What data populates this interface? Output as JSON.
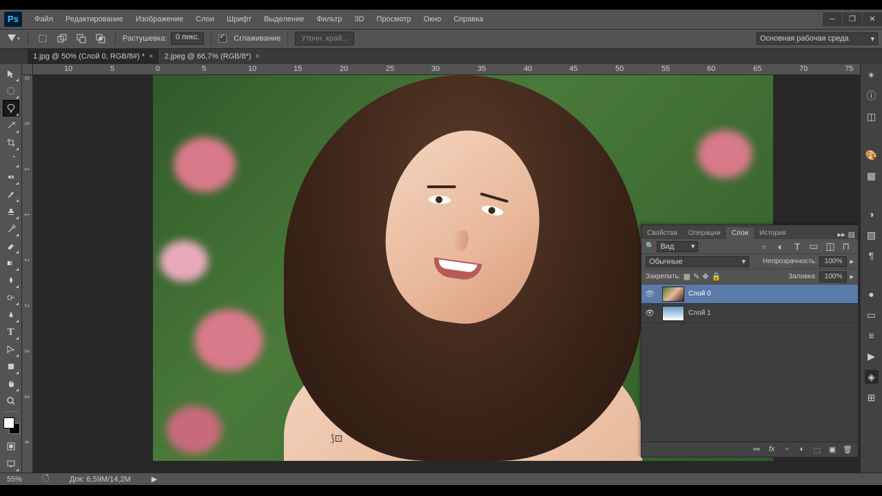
{
  "menubar": [
    "Файл",
    "Редактирование",
    "Изображение",
    "Слои",
    "Шрифт",
    "Выделение",
    "Фильтр",
    "3D",
    "Просмотр",
    "Окно",
    "Справка"
  ],
  "optbar": {
    "feather_label": "Растушевка:",
    "feather_value": "0 пикс.",
    "antialias_label": "Сглаживание",
    "refine_label": "Уточн. край..."
  },
  "workspace_dd": "Основная рабочая среда",
  "tabs": [
    {
      "label": "1.jpg @ 50% (Слой 0, RGB/8#) *",
      "active": true
    },
    {
      "label": "2.jpeg @ 66,7% (RGB/8*)",
      "active": false
    }
  ],
  "ruler_h": [
    "10",
    "5",
    "0",
    "5",
    "10",
    "15",
    "20",
    "25",
    "30",
    "35",
    "40",
    "45",
    "50",
    "55",
    "60",
    "65",
    "70",
    "75"
  ],
  "ruler_v": [
    "0",
    "5",
    "1",
    "1",
    "2",
    "2",
    "3",
    "3",
    "4"
  ],
  "panel": {
    "tabs": [
      "Свойства",
      "Операции",
      "Слои",
      "История"
    ],
    "active_tab": 2,
    "kind_label": "Вид",
    "blend_mode": "Обычные",
    "opacity_label": "Непрозрачность:",
    "opacity_val": "100%",
    "lock_label": "Закрепить:",
    "fill_label": "Заливка:",
    "fill_val": "100%",
    "layers": [
      {
        "name": "Слой 0",
        "selected": true,
        "thumb": "photo"
      },
      {
        "name": "Слой 1",
        "selected": false,
        "thumb": "sky"
      }
    ]
  },
  "status": {
    "zoom": "55%",
    "doc": "Док: 6,59M/14,2M"
  }
}
